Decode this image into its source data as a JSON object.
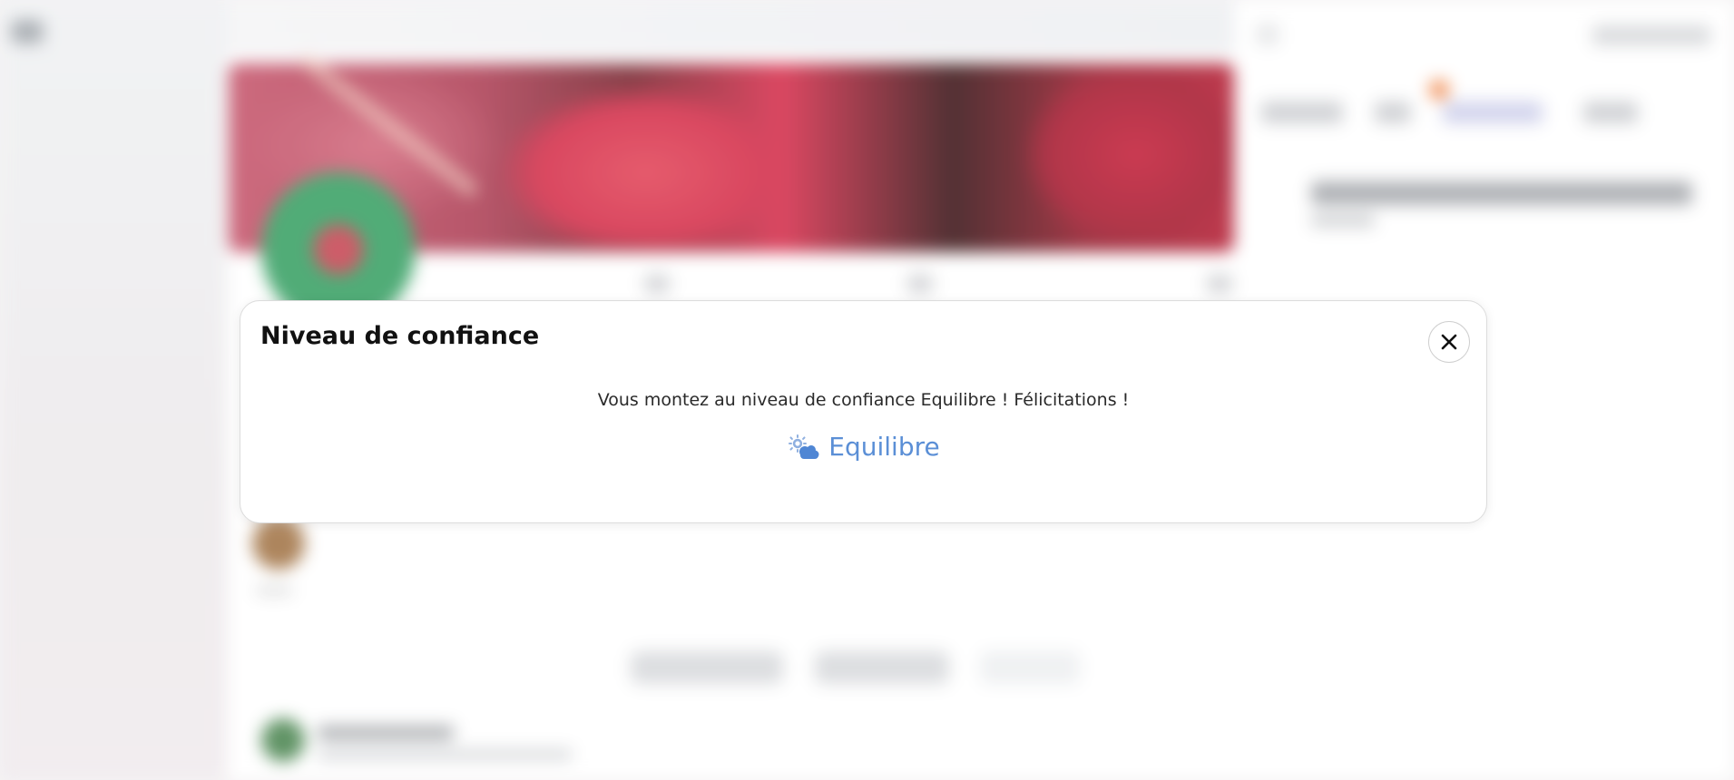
{
  "modal": {
    "title": "Niveau de confiance",
    "close_icon": "close-icon",
    "message": "Vous montez au niveau de confiance Equilibre ! Félicitations !",
    "level": {
      "name": "Equilibre",
      "icon": "sun-cloud-icon",
      "color": "#5b8fd6"
    }
  },
  "background": {
    "cover_colors": [
      "#c24a62",
      "#d11f3d",
      "#2d0508",
      "#a10a22"
    ],
    "notification_color": "#f07a36"
  }
}
